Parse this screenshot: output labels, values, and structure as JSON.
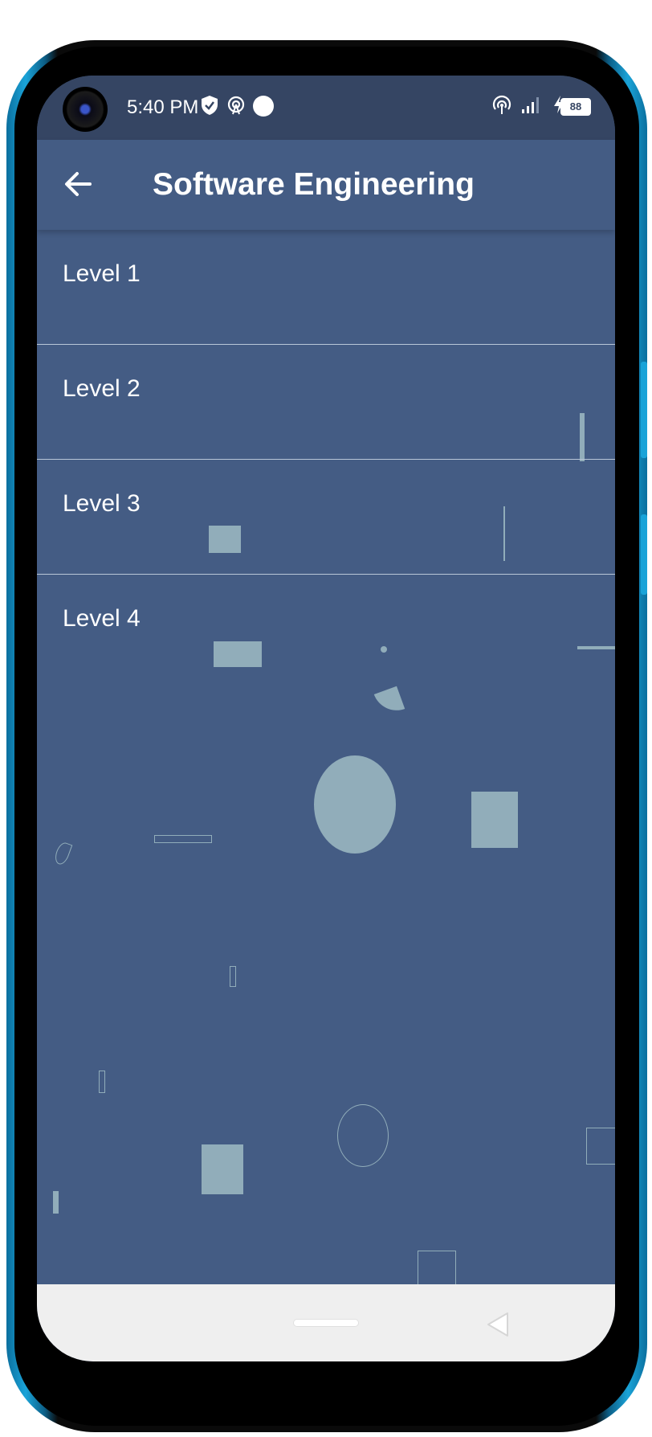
{
  "status_bar": {
    "time": "5:40 PM",
    "battery_level": "88",
    "icons": [
      "shield-check-icon",
      "hotspot-icon",
      "circle-dot-icon",
      "wireless-signal-icon",
      "cell-signal-icon",
      "charging-bolt-icon",
      "battery-icon"
    ]
  },
  "app_bar": {
    "title": "Software Engineering",
    "back_icon": "arrow-left-icon"
  },
  "levels": [
    {
      "label": "Level 1"
    },
    {
      "label": "Level 2"
    },
    {
      "label": "Level 3"
    },
    {
      "label": "Level 4"
    }
  ],
  "colors": {
    "background": "#445c84",
    "status_bar": "#354563",
    "divider": "#b9c7d8",
    "decorative_shapes": "#91adba",
    "nav_bar": "#efefef"
  },
  "nav_bar": {
    "home_icon": "home-pill-icon",
    "back_icon": "triangle-back-icon"
  }
}
